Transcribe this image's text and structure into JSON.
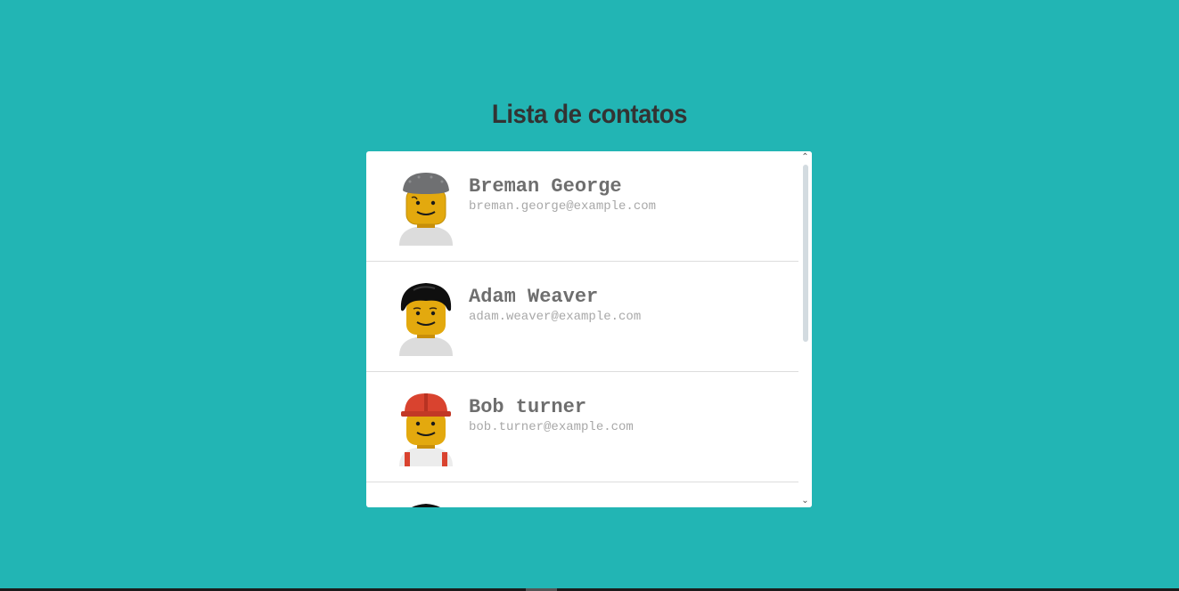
{
  "page": {
    "title": "Lista de contatos",
    "background_color": "#22b5b4",
    "title_color": "#333333"
  },
  "contacts": [
    {
      "name": "Breman George",
      "email": "breman.george@example.com",
      "avatar_icon": "lego-minifig-grey-beanie-icon",
      "hat_color": "#6f7072",
      "torso_color": "#dcdcdc"
    },
    {
      "name": "Adam Weaver",
      "email": "adam.weaver@example.com",
      "avatar_icon": "lego-minifig-black-hair-icon",
      "hat_color": "#0f0f0f",
      "torso_color": "#dcdcdc"
    },
    {
      "name": "Bob turner",
      "email": "bob.turner@example.com",
      "avatar_icon": "lego-minifig-red-hardhat-icon",
      "hat_color": "#d9432f",
      "torso_color": "#ececec"
    },
    {
      "name": "",
      "email": "",
      "avatar_icon": "lego-minifig-black-hair-icon",
      "hat_color": "#0f0f0f",
      "torso_color": "#dcdcdc"
    }
  ],
  "scrollbar": {
    "up_arrow": "⌃",
    "down_arrow": "⌄"
  }
}
